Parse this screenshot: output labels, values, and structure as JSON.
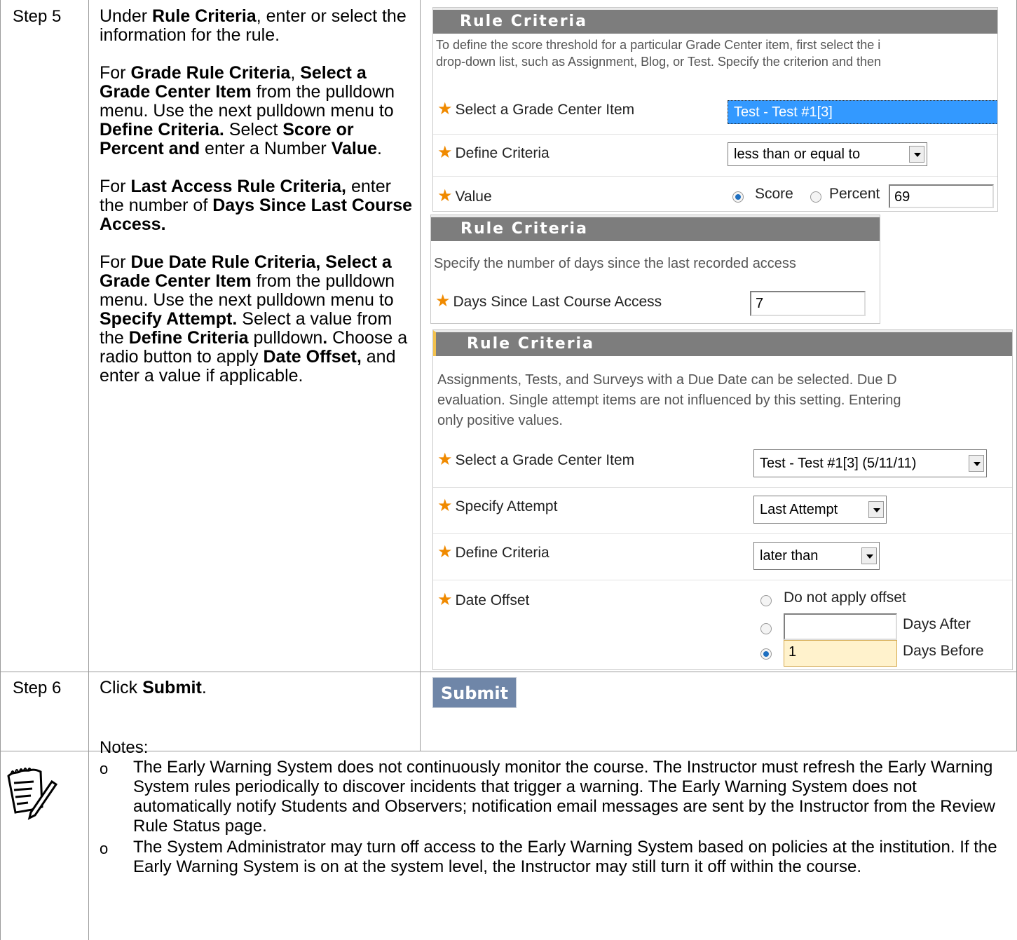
{
  "steps": {
    "step5_label": "Step 5",
    "step6_label": "Step 6"
  },
  "step5": {
    "p1_a": "Under ",
    "p1_b": "Rule Criteria",
    "p1_c": ", enter or select the information for the rule.",
    "p2_a": "For ",
    "p2_b": "Grade Rule Criteria",
    "p2_c": ", ",
    "p2_d": "Select a Grade Center Item",
    "p2_e": " from the pulldown menu. Use the next pulldown menu to ",
    "p2_f": "Define Criteria.",
    "p2_g": " Select ",
    "p2_h": "Score or Percent and",
    "p2_i": " enter a Number ",
    "p2_j": "Value",
    "p2_k": ".",
    "p3_a": "For ",
    "p3_b": "Last Access Rule Criteria,",
    "p3_c": " enter the number of ",
    "p3_d": "Days Since Last Course Access.",
    "p4_a": "For ",
    "p4_b": "Due Date Rule Criteria, Select a Grade Center Item",
    "p4_c": " from the pulldown menu. Use the next pulldown menu to ",
    "p4_d": "Specify Attempt.",
    "p4_e": " Select a value from the ",
    "p4_f": "Define Criteria",
    "p4_g": " pulldown",
    "p4_h": ".",
    "p4_i": " Choose a radio button to apply ",
    "p4_j": "Date Offset,",
    "p4_k": " and enter a value if applicable."
  },
  "panel1": {
    "header": "Rule Criteria",
    "desc1": "To define the score threshold for a particular Grade Center item, first select the i",
    "desc2": "drop-down list, such as Assignment, Blog, or Test. Specify the criterion and then",
    "item_label": "Select a Grade Center Item",
    "item_value": "Test - Test #1[3]",
    "criteria_label": "Define Criteria",
    "criteria_value": "less than or equal to",
    "value_label": "Value",
    "score_label": "Score",
    "percent_label": "Percent",
    "value_input": "69"
  },
  "panel2": {
    "header": "Rule Criteria",
    "desc": "Specify the number of days since the last recorded access",
    "days_label": "Days Since Last Course Access",
    "days_value": "7"
  },
  "panel3": {
    "header": "Rule Criteria",
    "desc1": "Assignments, Tests, and Surveys with a Due Date can be selected. Due D",
    "desc2": "evaluation. Single attempt items are not influenced by this setting. Entering",
    "desc3": "only positive values.",
    "item_label": "Select a Grade Center Item",
    "item_value": "Test - Test #1[3] (5/11/11)",
    "attempt_label": "Specify Attempt",
    "attempt_value": "Last Attempt",
    "criteria_label": "Define Criteria",
    "criteria_value": "later than",
    "offset_label": "Date Offset",
    "opt_none": "Do not apply offset",
    "opt_after": "Days After",
    "opt_before": "Days Before",
    "after_value": "",
    "before_value": "1"
  },
  "step6": {
    "a": "Click ",
    "b": "Submit",
    "c": ".",
    "submit_label": "Submit"
  },
  "notes": {
    "title": "Notes:",
    "bullet": "o",
    "item1": "The Early Warning System does not continuously monitor the course. The Instructor must refresh the Early Warning System rules periodically to discover incidents that trigger a warning. The Early Warning System does not automatically notify Students and Observers; notification email messages are sent by the Instructor from the Review Rule Status page.",
    "item2": "The System Administrator may turn off access to the Early Warning System based on policies at the institution. If the Early Warning System is on at the system level, the Instructor may still turn it off within the course."
  },
  "colors": {
    "header_bg": "#7d7d7d",
    "star": "#f08a00",
    "selected_blue": "#3399ff",
    "highlight_input": "#fff2cc",
    "submit_bg": "#6f86a8"
  }
}
